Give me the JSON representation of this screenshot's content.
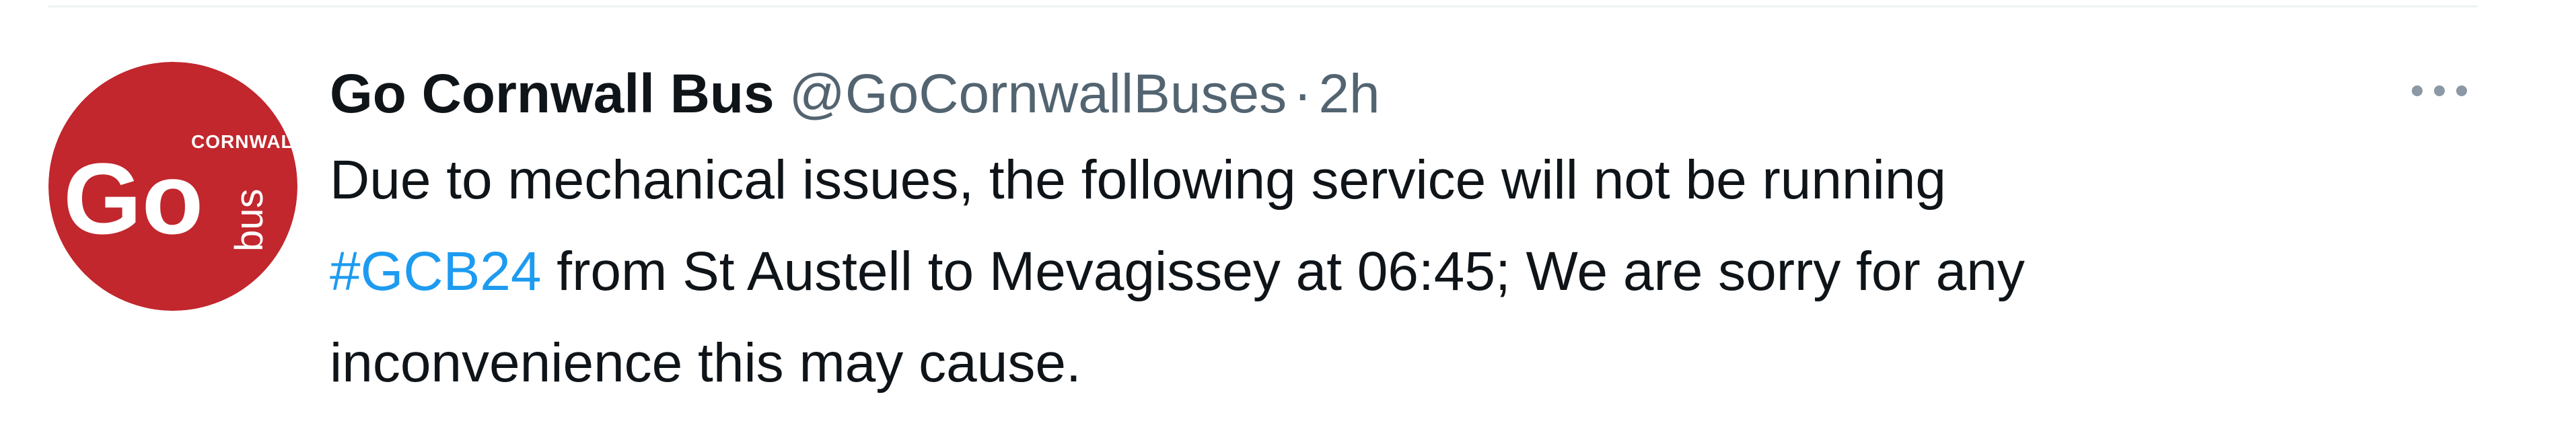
{
  "divider": true,
  "tweet": {
    "avatar": {
      "icon": "go-cornwall-bus-logo",
      "brand_color": "#c1272d",
      "logo_text_small": "CORNWALL",
      "logo_text_main": "Go",
      "logo_text_side": "bus"
    },
    "author": {
      "display_name": "Go Cornwall Bus",
      "handle": "@GoCornwallBuses"
    },
    "separator": "·",
    "time": "2h",
    "more_icon": "more-horizontal-icon",
    "text": {
      "line1": "Due to mechanical issues, the following service will not be running",
      "hashtag": "#GCB24",
      "line2_rest": " from St Austell to Mevagissey at 06:45; We are sorry for any",
      "line3": "inconvenience this may cause."
    },
    "colors": {
      "text": "#0f1419",
      "secondary": "#536471",
      "link": "#1d9bf0"
    }
  }
}
